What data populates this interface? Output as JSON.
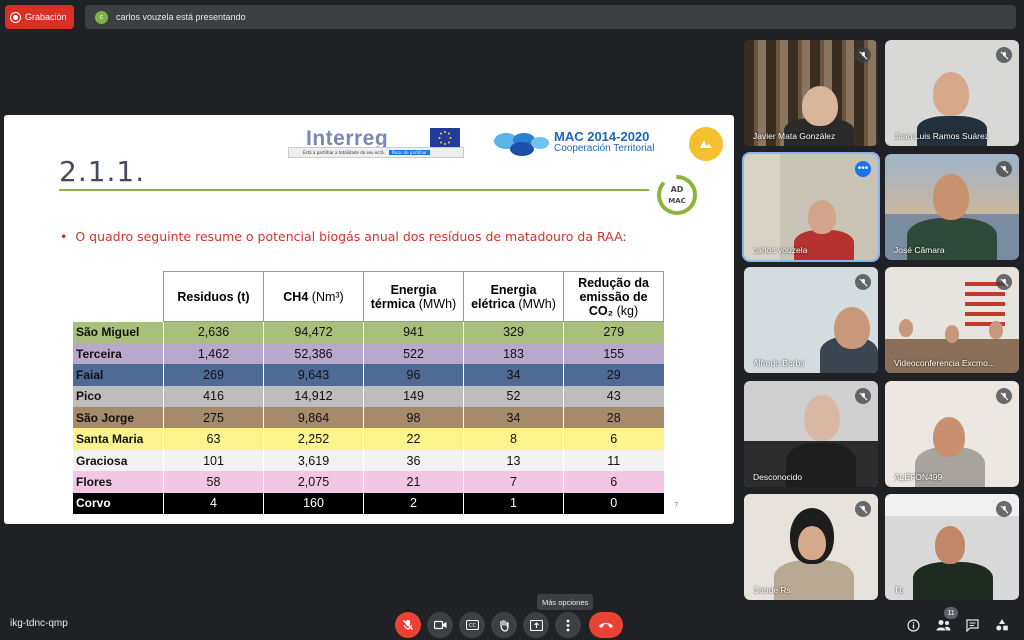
{
  "topbar": {
    "recording_label": "Grabación",
    "presenter_initial": "c",
    "presenting_text": "carlos vouzela está presentando"
  },
  "slide": {
    "interreg_logo_text": "Interreg",
    "share_notice": "Está a partilhar a totalidade do seu ecrã.",
    "share_stop_label": "Parar de partilhar",
    "mac_title": "MAC 2014-2020",
    "mac_subtitle": "Cooperación Territorial",
    "ad_mac_logo_text": "AD4MAC",
    "heading": "2.1.1.",
    "bullet": "O quadro seguinte resume o potencial biogás anual dos resíduos de matadouro da RAA:",
    "page_number": "7",
    "table": {
      "headers": [
        {
          "main": "Residuos (t)",
          "unit": ""
        },
        {
          "main": "CH4",
          "unit": "(Nm³)"
        },
        {
          "main": "Energia térmica",
          "unit": "(MWh)"
        },
        {
          "main": "Energia elétrica",
          "unit": "(MWh)"
        },
        {
          "main": "Redução da emissão de CO₂",
          "unit": "(kg)"
        }
      ],
      "rows": [
        {
          "island": "São Miguel",
          "bg": "#a8c07a",
          "fg": "#111111",
          "values": [
            "2,636",
            "94,472",
            "941",
            "329",
            "279"
          ]
        },
        {
          "island": "Terceira",
          "bg": "#b7a8cc",
          "fg": "#111111",
          "values": [
            "1,462",
            "52,386",
            "522",
            "183",
            "155"
          ]
        },
        {
          "island": "Faial",
          "bg": "#4f6a94",
          "fg": "#111111",
          "values": [
            "269",
            "9,643",
            "96",
            "34",
            "29"
          ]
        },
        {
          "island": "Pico",
          "bg": "#bdbdbd",
          "fg": "#111111",
          "values": [
            "416",
            "14,912",
            "149",
            "52",
            "43"
          ]
        },
        {
          "island": "São Jorge",
          "bg": "#a58a6c",
          "fg": "#111111",
          "values": [
            "275",
            "9,864",
            "98",
            "34",
            "28"
          ]
        },
        {
          "island": "Santa Maria",
          "bg": "#fbf48c",
          "fg": "#111111",
          "values": [
            "63",
            "2,252",
            "22",
            "8",
            "6"
          ]
        },
        {
          "island": "Graciosa",
          "bg": "#f2f2f2",
          "fg": "#111111",
          "values": [
            "101",
            "3,619",
            "36",
            "13",
            "11"
          ]
        },
        {
          "island": "Flores",
          "bg": "#f3c6e4",
          "fg": "#111111",
          "values": [
            "58",
            "2,075",
            "21",
            "7",
            "6"
          ]
        },
        {
          "island": "Corvo",
          "bg": "#000000",
          "fg": "#ffffff",
          "values": [
            "4",
            "160",
            "2",
            "1",
            "0"
          ]
        }
      ]
    }
  },
  "participants": [
    {
      "name": "Javier Mata González",
      "muted": true
    },
    {
      "name": "Juan Luis Ramos Suárez",
      "muted": true
    },
    {
      "name": "carlos vouzela",
      "muted": false,
      "active": true
    },
    {
      "name": "José Câmara",
      "muted": true
    },
    {
      "name": "Alfredo Borba",
      "muted": true
    },
    {
      "name": "Videoconferencia Excmo...",
      "muted": true
    },
    {
      "name": "Desconocido",
      "muted": true
    },
    {
      "name": "ALEFON499",
      "muted": true
    },
    {
      "name": "Cande Rs",
      "muted": true
    },
    {
      "name": "Tú",
      "muted": true
    }
  ],
  "bottombar": {
    "meeting_code": "ikg-tdnc-qmp",
    "tooltip": "Más opciones",
    "participant_count": "11",
    "controls": [
      "mic-off-icon",
      "camera-icon",
      "captions-icon",
      "raise-hand-icon",
      "present-icon",
      "more-options-icon",
      "hang-up-icon"
    ]
  },
  "colors": {
    "accent_red": "#ea4335",
    "accent_blue": "#1a73e8",
    "background": "#202124"
  }
}
